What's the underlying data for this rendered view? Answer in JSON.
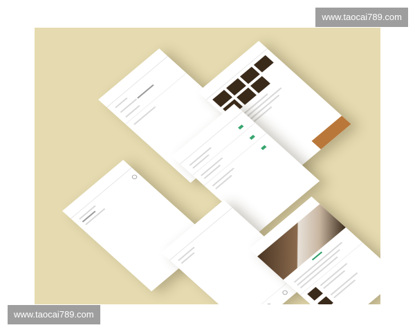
{
  "watermark": {
    "top_text": "www.taocai789.com",
    "bottom_text": "www.taocai789.com"
  },
  "colors": {
    "background": "#e6dbb0",
    "accent_orange": "#b9773a",
    "accent_green": "#2f9d68"
  }
}
